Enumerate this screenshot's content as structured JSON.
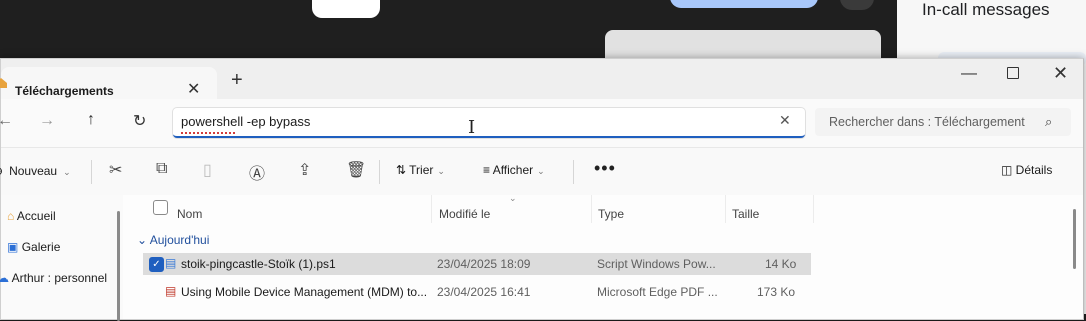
{
  "meeting": {
    "side_panel_title": "In-call messages"
  },
  "explorer": {
    "tab_title": "Téléchargements",
    "address_value": "powershell -ep bypass",
    "search_placeholder": "Rechercher dans : Téléchargements",
    "toolbar": {
      "new_label": "Nouveau",
      "sort_label": "Trier",
      "view_label": "Afficher",
      "more_label": "•••",
      "details_label": "Détails"
    },
    "nav_items": [
      {
        "label": "Accueil",
        "icon": "home-icon"
      },
      {
        "label": "Galerie",
        "icon": "gallery-icon"
      },
      {
        "label": "Arthur : personnel",
        "icon": "onedrive-cloud-icon"
      }
    ],
    "columns": [
      "Nom",
      "Modifié le",
      "Type",
      "Taille"
    ],
    "group_label": "Aujourd'hui",
    "files": [
      {
        "name": "stoik-pingcastle-Stoïk (1).ps1",
        "modified": "23/04/2025 18:09",
        "type": "Script Windows Pow...",
        "size": "14 Ko",
        "selected": true,
        "icon": "powershell-script-icon"
      },
      {
        "name": "Using Mobile Device Management (MDM) to...",
        "modified": "23/04/2025 16:41",
        "type": "Microsoft Edge PDF ...",
        "size": "173 Ko",
        "selected": false,
        "icon": "pdf-file-icon"
      }
    ]
  },
  "colors": {
    "accent": "#1f5fbf",
    "selection": "#dcdcdc",
    "group_text": "#1f4e9c"
  }
}
